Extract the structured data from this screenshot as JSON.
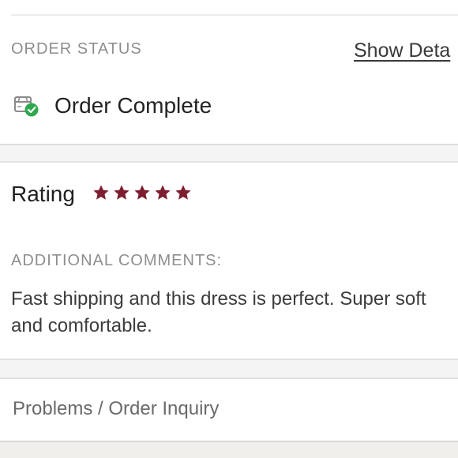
{
  "order_status": {
    "label": "ORDER STATUS",
    "show_details": "Show Deta",
    "status_text": "Order Complete",
    "status_icon": "package-check-icon",
    "check_color": "#2fa84f"
  },
  "rating": {
    "title": "Rating",
    "stars": 5,
    "max_stars": 5,
    "star_color": "#7d1f30"
  },
  "comments": {
    "label": "ADDITIONAL COMMENTS:",
    "text": "Fast shipping and this dress is perfect. Super soft and comfortable."
  },
  "problems": {
    "label": "Problems / Order Inquiry"
  }
}
